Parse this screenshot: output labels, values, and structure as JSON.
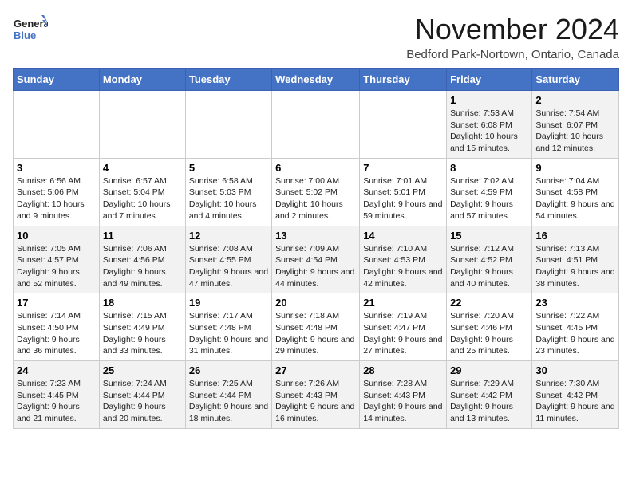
{
  "logo": {
    "line1": "General",
    "line2": "Blue"
  },
  "title": "November 2024",
  "subtitle": "Bedford Park-Nortown, Ontario, Canada",
  "days_of_week": [
    "Sunday",
    "Monday",
    "Tuesday",
    "Wednesday",
    "Thursday",
    "Friday",
    "Saturday"
  ],
  "weeks": [
    [
      {
        "day": "",
        "info": ""
      },
      {
        "day": "",
        "info": ""
      },
      {
        "day": "",
        "info": ""
      },
      {
        "day": "",
        "info": ""
      },
      {
        "day": "",
        "info": ""
      },
      {
        "day": "1",
        "info": "Sunrise: 7:53 AM\nSunset: 6:08 PM\nDaylight: 10 hours and 15 minutes."
      },
      {
        "day": "2",
        "info": "Sunrise: 7:54 AM\nSunset: 6:07 PM\nDaylight: 10 hours and 12 minutes."
      }
    ],
    [
      {
        "day": "3",
        "info": "Sunrise: 6:56 AM\nSunset: 5:06 PM\nDaylight: 10 hours and 9 minutes."
      },
      {
        "day": "4",
        "info": "Sunrise: 6:57 AM\nSunset: 5:04 PM\nDaylight: 10 hours and 7 minutes."
      },
      {
        "day": "5",
        "info": "Sunrise: 6:58 AM\nSunset: 5:03 PM\nDaylight: 10 hours and 4 minutes."
      },
      {
        "day": "6",
        "info": "Sunrise: 7:00 AM\nSunset: 5:02 PM\nDaylight: 10 hours and 2 minutes."
      },
      {
        "day": "7",
        "info": "Sunrise: 7:01 AM\nSunset: 5:01 PM\nDaylight: 9 hours and 59 minutes."
      },
      {
        "day": "8",
        "info": "Sunrise: 7:02 AM\nSunset: 4:59 PM\nDaylight: 9 hours and 57 minutes."
      },
      {
        "day": "9",
        "info": "Sunrise: 7:04 AM\nSunset: 4:58 PM\nDaylight: 9 hours and 54 minutes."
      }
    ],
    [
      {
        "day": "10",
        "info": "Sunrise: 7:05 AM\nSunset: 4:57 PM\nDaylight: 9 hours and 52 minutes."
      },
      {
        "day": "11",
        "info": "Sunrise: 7:06 AM\nSunset: 4:56 PM\nDaylight: 9 hours and 49 minutes."
      },
      {
        "day": "12",
        "info": "Sunrise: 7:08 AM\nSunset: 4:55 PM\nDaylight: 9 hours and 47 minutes."
      },
      {
        "day": "13",
        "info": "Sunrise: 7:09 AM\nSunset: 4:54 PM\nDaylight: 9 hours and 44 minutes."
      },
      {
        "day": "14",
        "info": "Sunrise: 7:10 AM\nSunset: 4:53 PM\nDaylight: 9 hours and 42 minutes."
      },
      {
        "day": "15",
        "info": "Sunrise: 7:12 AM\nSunset: 4:52 PM\nDaylight: 9 hours and 40 minutes."
      },
      {
        "day": "16",
        "info": "Sunrise: 7:13 AM\nSunset: 4:51 PM\nDaylight: 9 hours and 38 minutes."
      }
    ],
    [
      {
        "day": "17",
        "info": "Sunrise: 7:14 AM\nSunset: 4:50 PM\nDaylight: 9 hours and 36 minutes."
      },
      {
        "day": "18",
        "info": "Sunrise: 7:15 AM\nSunset: 4:49 PM\nDaylight: 9 hours and 33 minutes."
      },
      {
        "day": "19",
        "info": "Sunrise: 7:17 AM\nSunset: 4:48 PM\nDaylight: 9 hours and 31 minutes."
      },
      {
        "day": "20",
        "info": "Sunrise: 7:18 AM\nSunset: 4:48 PM\nDaylight: 9 hours and 29 minutes."
      },
      {
        "day": "21",
        "info": "Sunrise: 7:19 AM\nSunset: 4:47 PM\nDaylight: 9 hours and 27 minutes."
      },
      {
        "day": "22",
        "info": "Sunrise: 7:20 AM\nSunset: 4:46 PM\nDaylight: 9 hours and 25 minutes."
      },
      {
        "day": "23",
        "info": "Sunrise: 7:22 AM\nSunset: 4:45 PM\nDaylight: 9 hours and 23 minutes."
      }
    ],
    [
      {
        "day": "24",
        "info": "Sunrise: 7:23 AM\nSunset: 4:45 PM\nDaylight: 9 hours and 21 minutes."
      },
      {
        "day": "25",
        "info": "Sunrise: 7:24 AM\nSunset: 4:44 PM\nDaylight: 9 hours and 20 minutes."
      },
      {
        "day": "26",
        "info": "Sunrise: 7:25 AM\nSunset: 4:44 PM\nDaylight: 9 hours and 18 minutes."
      },
      {
        "day": "27",
        "info": "Sunrise: 7:26 AM\nSunset: 4:43 PM\nDaylight: 9 hours and 16 minutes."
      },
      {
        "day": "28",
        "info": "Sunrise: 7:28 AM\nSunset: 4:43 PM\nDaylight: 9 hours and 14 minutes."
      },
      {
        "day": "29",
        "info": "Sunrise: 7:29 AM\nSunset: 4:42 PM\nDaylight: 9 hours and 13 minutes."
      },
      {
        "day": "30",
        "info": "Sunrise: 7:30 AM\nSunset: 4:42 PM\nDaylight: 9 hours and 11 minutes."
      }
    ]
  ]
}
